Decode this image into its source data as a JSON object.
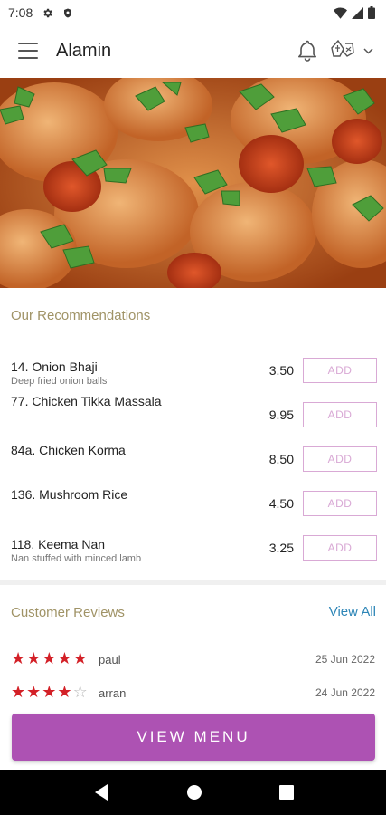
{
  "status_bar": {
    "time": "7:08"
  },
  "app_bar": {
    "title": "Alamin"
  },
  "recommendations": {
    "title": "Our Recommendations",
    "add_label": "ADD",
    "items": [
      {
        "name": "14. Onion Bhaji",
        "description": "Deep fried onion balls",
        "price": "3.50"
      },
      {
        "name": "77. Chicken Tikka Massala",
        "description": "",
        "price": "9.95"
      },
      {
        "name": "84a. Chicken Korma",
        "description": "",
        "price": "8.50"
      },
      {
        "name": "136. Mushroom Rice",
        "description": "",
        "price": "4.50"
      },
      {
        "name": "118. Keema Nan",
        "description": "Nan stuffed with minced lamb",
        "price": "3.25"
      }
    ]
  },
  "reviews": {
    "title": "Customer Reviews",
    "view_all": "View All",
    "items": [
      {
        "name": "paul",
        "date": "25 Jun 2022",
        "rating": 5
      },
      {
        "name": "arran",
        "date": "24 Jun 2022",
        "rating": 4
      }
    ]
  },
  "view_menu_label": "VIEW MENU",
  "colors": {
    "accent": "#ad52b3",
    "star": "#d32027",
    "link": "#2e86b7",
    "section_title": "#a09366"
  }
}
